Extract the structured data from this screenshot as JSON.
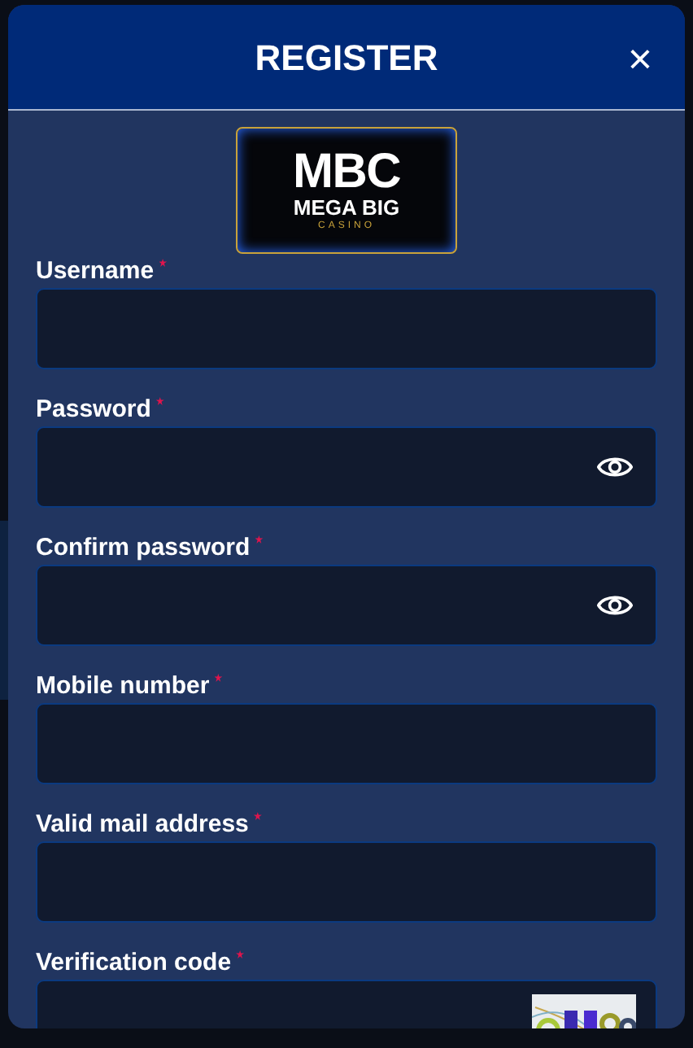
{
  "dialog": {
    "title": "REGISTER",
    "close": "×"
  },
  "logo": {
    "big": "MBC",
    "middle": "MEGA BIG",
    "small": "CASINO"
  },
  "fields": [
    {
      "label": "Username",
      "required": true,
      "kind": "text"
    },
    {
      "label": "Password",
      "required": true,
      "kind": "password"
    },
    {
      "label": "Confirm password",
      "required": true,
      "kind": "password"
    },
    {
      "label": "Mobile number",
      "required": true,
      "kind": "text"
    },
    {
      "label": "Valid mail address",
      "required": true,
      "kind": "text"
    },
    {
      "label": "Verification code",
      "required": true,
      "kind": "captcha"
    }
  ]
}
